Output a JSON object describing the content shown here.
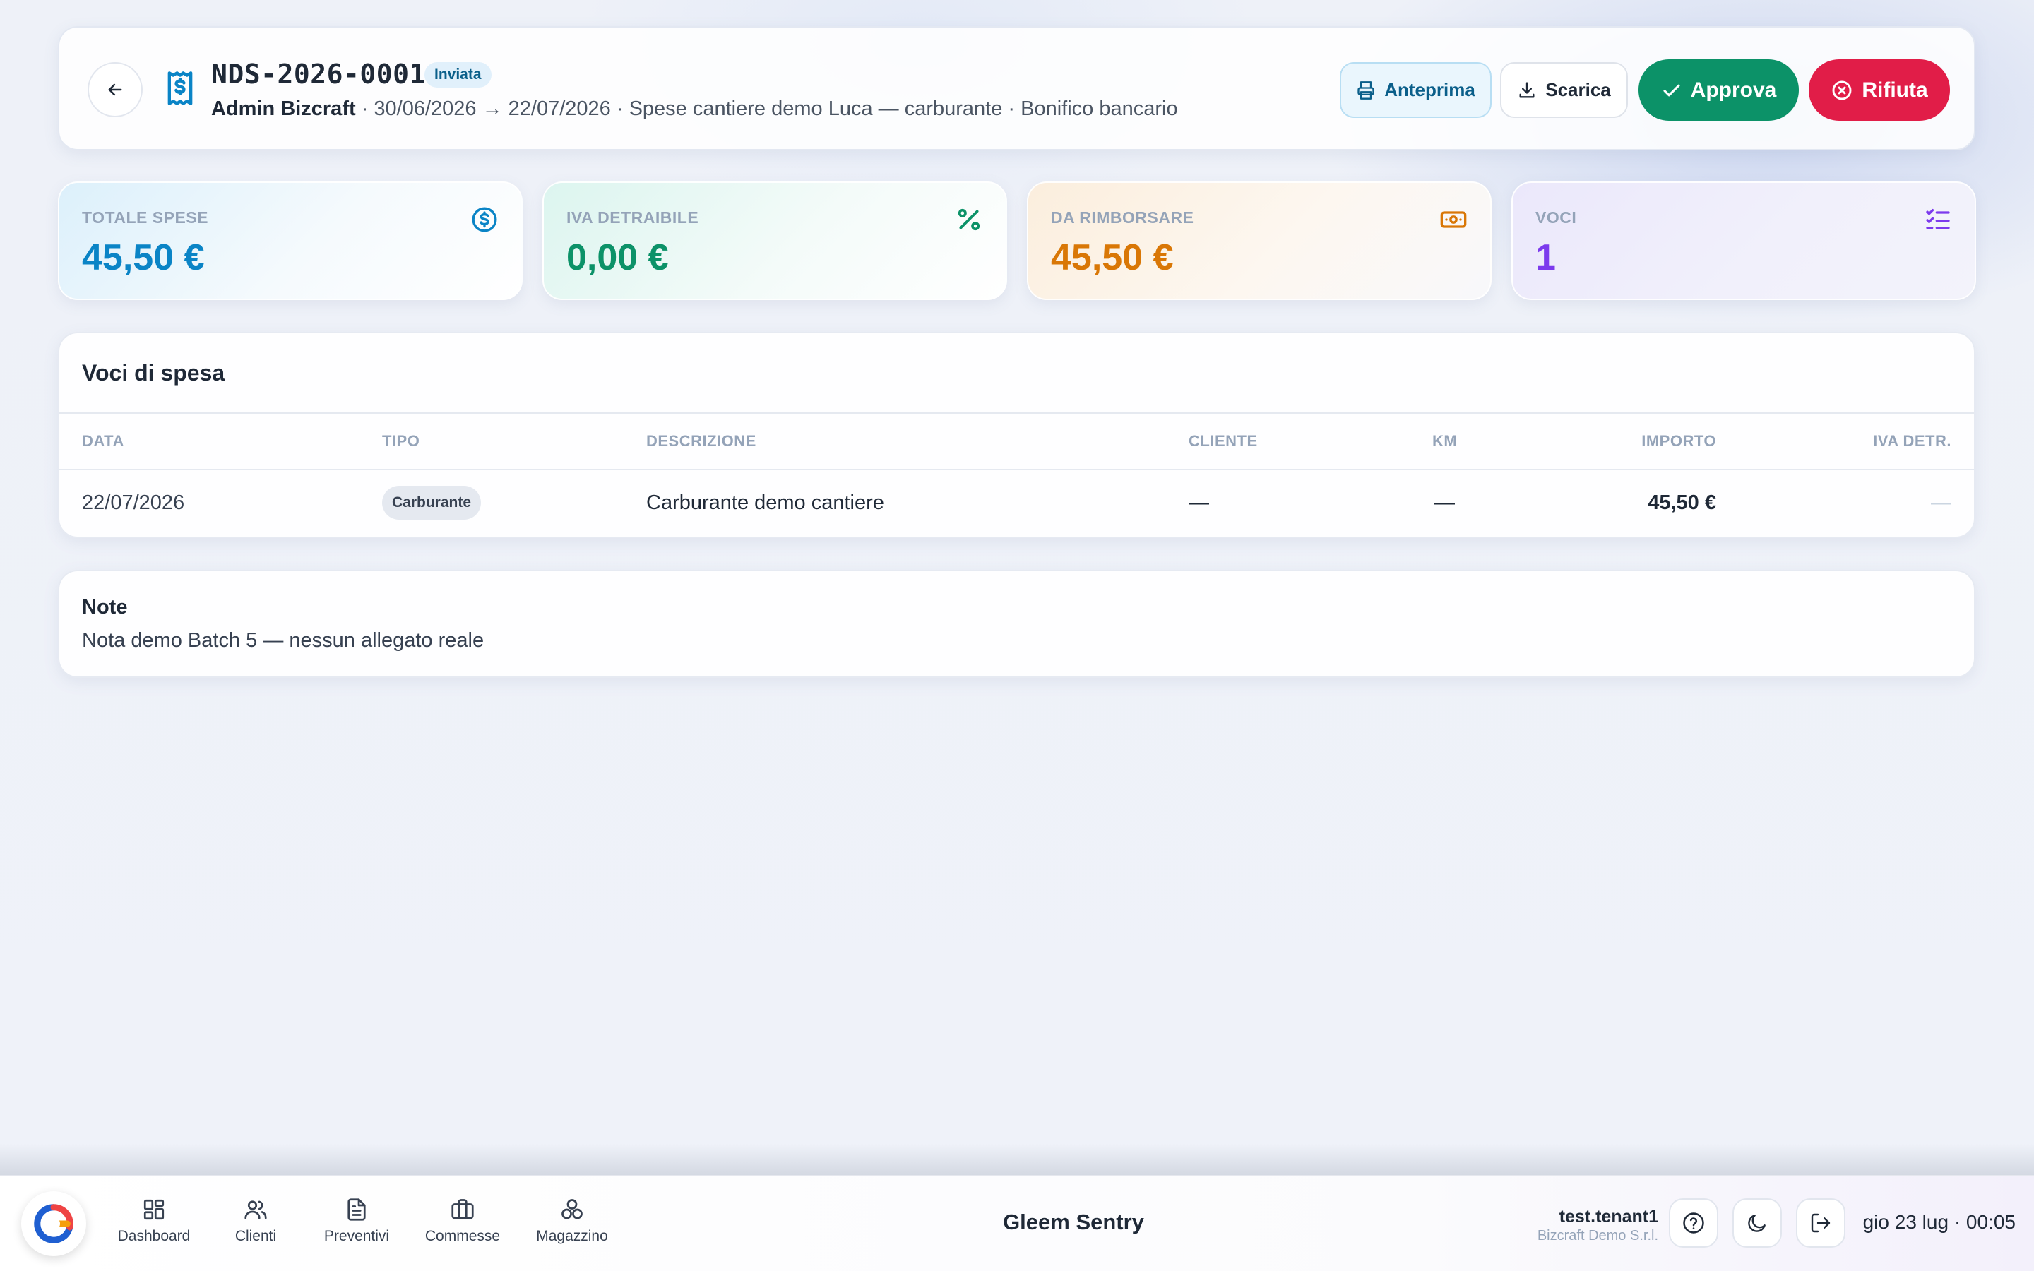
{
  "header": {
    "doc_number": "NDS-2026-0001",
    "status": "Inviata",
    "author": "Admin Bizcraft",
    "meta": " · 30/06/2026 → 22/07/2026 · Spese cantiere demo Luca — carburante · Bonifico bancario",
    "buttons": {
      "preview": "Anteprima",
      "download": "Scarica",
      "approve": "Approva",
      "reject": "Rifiuta"
    }
  },
  "stats": [
    {
      "label": "TOTALE SPESE",
      "value": "45,50 €",
      "color": "#0a84c6",
      "icon": "dollar-circle-icon"
    },
    {
      "label": "IVA DETRAIBILE",
      "value": "0,00 €",
      "color": "#0c9268",
      "icon": "percent-icon"
    },
    {
      "label": "DA RIMBORSARE",
      "value": "45,50 €",
      "color": "#d97706",
      "icon": "banknote-icon"
    },
    {
      "label": "VOCI",
      "value": "1",
      "color": "#7c3aed",
      "icon": "checklist-icon"
    }
  ],
  "expenses": {
    "title": "Voci di spesa",
    "columns": [
      "DATA",
      "TIPO",
      "DESCRIZIONE",
      "CLIENTE",
      "KM",
      "IMPORTO",
      "IVA DETR."
    ],
    "rows": [
      {
        "date": "22/07/2026",
        "type": "Carburante",
        "description": "Carburante demo cantiere",
        "client": "—",
        "km": "—",
        "amount": "45,50 €",
        "vat": "—"
      }
    ]
  },
  "notes": {
    "title": "Note",
    "text": "Nota demo Batch 5 — nessun allegato reale"
  },
  "bottom_nav": {
    "items": [
      {
        "label": "Dashboard",
        "icon": "dashboard-icon"
      },
      {
        "label": "Clienti",
        "icon": "users-icon"
      },
      {
        "label": "Preventivi",
        "icon": "document-icon"
      },
      {
        "label": "Commesse",
        "icon": "briefcase-icon"
      },
      {
        "label": "Magazzino",
        "icon": "boxes-icon"
      }
    ],
    "app_title": "Gleem Sentry",
    "user": "test.tenant1",
    "company": "Bizcraft Demo S.r.l.",
    "clock": "gio 23 lug · 00:05"
  },
  "colors": {
    "accent_blue": "#0a84c6",
    "approve_green": "#0c9268",
    "reject_red": "#e11d48"
  }
}
